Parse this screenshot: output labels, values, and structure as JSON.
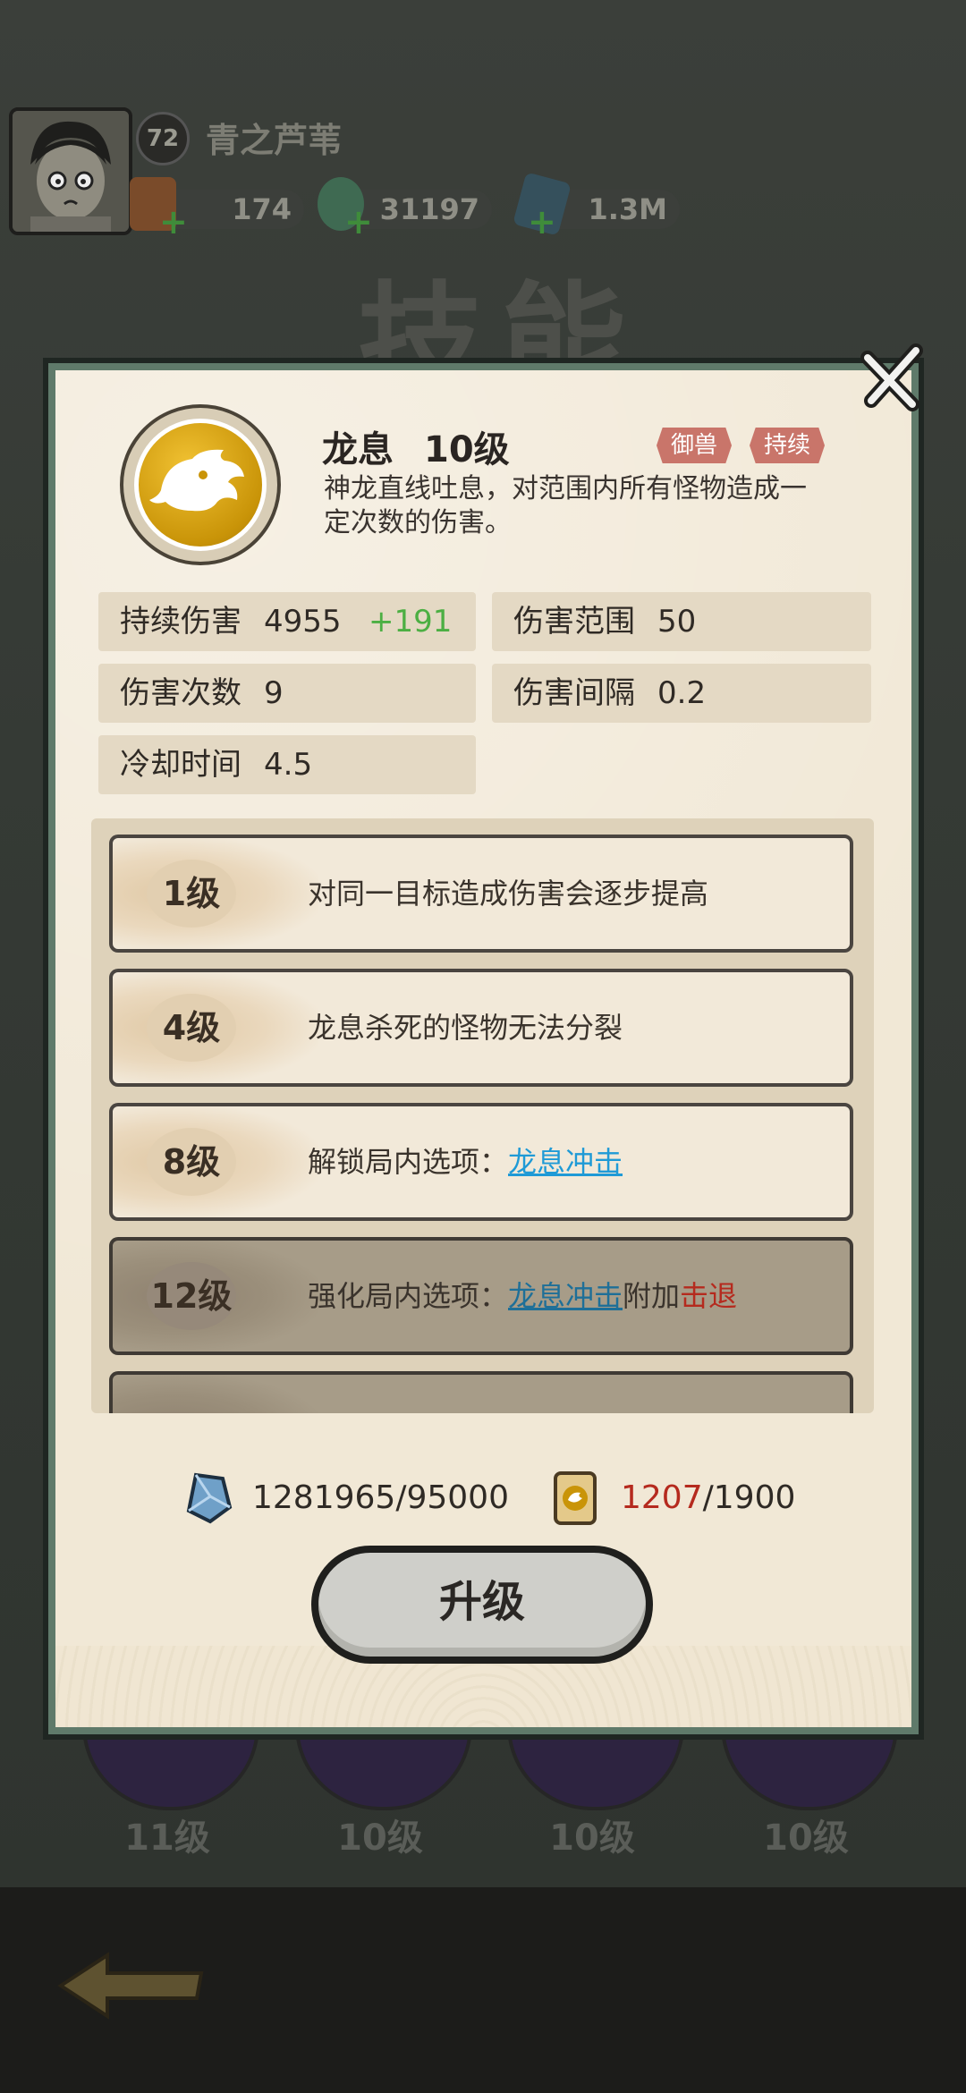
{
  "player": {
    "level": "72",
    "name": "青之芦苇"
  },
  "resources": [
    {
      "icon": "scroll-icon",
      "value": "174"
    },
    {
      "icon": "jade-dragon-icon",
      "value": "31197"
    },
    {
      "icon": "crystal-icon",
      "value": "1.3M"
    }
  ],
  "background_title": "技能",
  "skill": {
    "name": "龙息",
    "level": "10级",
    "tags": [
      "御兽",
      "持续"
    ],
    "description": "神龙直线吐息，对范围内所有怪物造成一定次数的伤害。"
  },
  "stats": [
    {
      "label": "持续伤害",
      "value": "4955",
      "increase": "+191"
    },
    {
      "label": "伤害范围",
      "value": "50"
    },
    {
      "label": "伤害次数",
      "value": "9"
    },
    {
      "label": "伤害间隔",
      "value": "0.2"
    },
    {
      "label": "冷却时间",
      "value": "4.5"
    }
  ],
  "upgrades": [
    {
      "level": "1级",
      "text": "对同一目标造成伤害会逐步提高"
    },
    {
      "level": "4级",
      "text": "龙息杀死的怪物无法分裂"
    },
    {
      "level": "8级",
      "prefix": "解锁局内选项：",
      "link": "龙息冲击"
    },
    {
      "level": "12级",
      "prefix": "强化局内选项：",
      "link": "龙息冲击",
      "mid": "附加",
      "highlight": "击退"
    }
  ],
  "cost": {
    "crystal_have": "1281965",
    "crystal_need": "/95000",
    "scroll_have": "1207",
    "scroll_need": "/1900"
  },
  "upgrade_button": "升级",
  "bottom_skills": [
    "11级",
    "10级",
    "10级",
    "10级"
  ],
  "colors": {
    "accent_green": "#4caf43",
    "link_blue": "#1f9ad6",
    "warn_red": "#b52a1e",
    "tag_red": "#c9756a",
    "frame_green": "#5f7a6a"
  }
}
